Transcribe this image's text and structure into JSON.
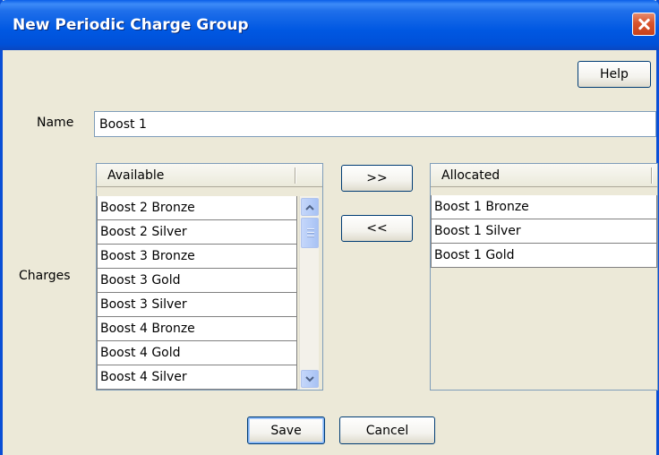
{
  "window": {
    "title": "New Periodic Charge Group",
    "close_icon": "close-icon"
  },
  "toolbar": {
    "help_label": "Help"
  },
  "form": {
    "name_label": "Name",
    "name_value": "Boost 1",
    "charges_label": "Charges"
  },
  "available": {
    "header": "Available",
    "items": [
      "Boost 2 Bronze",
      "Boost 2 Silver",
      "Boost 3 Bronze",
      "Boost 3 Gold",
      "Boost 3 Silver",
      "Boost 4 Bronze",
      "Boost 4 Gold",
      "Boost 4 Silver"
    ],
    "scroll_up_icon": "chevron-up-icon",
    "scroll_down_icon": "chevron-down-icon"
  },
  "transfer": {
    "add_label": ">>",
    "remove_label": "<<"
  },
  "allocated": {
    "header": "Allocated",
    "items": [
      "Boost 1 Bronze",
      "Boost 1 Silver",
      "Boost 1 Gold"
    ]
  },
  "footer": {
    "save_label": "Save",
    "cancel_label": "Cancel"
  },
  "colors": {
    "titlebar": "#0058E2",
    "window_bg": "#ECE9D8",
    "close_button": "#D9542C",
    "field_border": "#7F9DB9"
  }
}
